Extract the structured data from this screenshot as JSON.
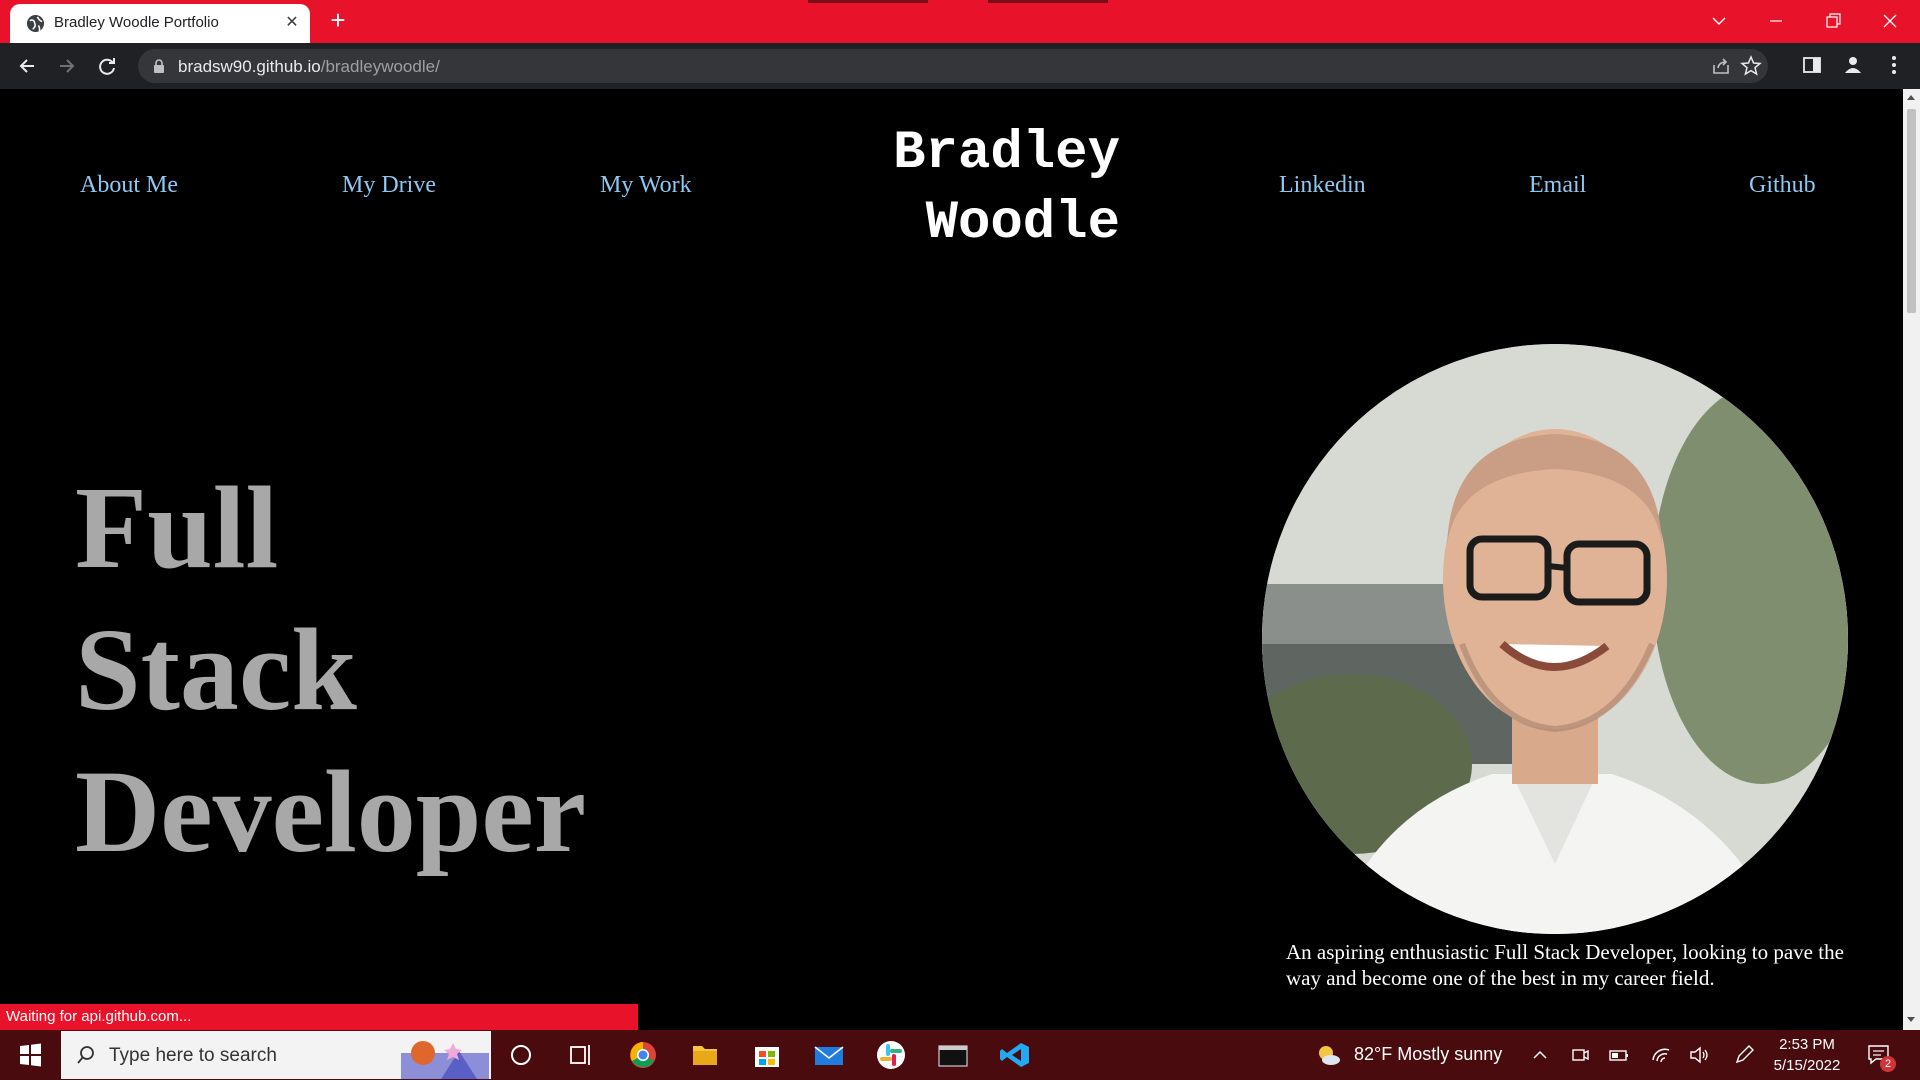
{
  "browser": {
    "tab_title": "Bradley Woodle Portfolio",
    "new_tab_icon": "plus-icon",
    "url_host": "bradsw90.github.io",
    "url_path": "/bradleywoodle/",
    "status_text": "Waiting for api.github.com..."
  },
  "page": {
    "nav_left": [
      "About Me",
      "My Drive",
      "My Work"
    ],
    "site_title_line1": "Bradley",
    "site_title_line2": "Woodle",
    "nav_right": [
      "Linkedin",
      "Email",
      "Github"
    ],
    "hero_line1": "Full",
    "hero_line2": "Stack",
    "hero_line3": "Developer",
    "bio": "An aspiring enthusiastic Full Stack Developer, looking to pave the way and become one of the best in my career field.",
    "colors": {
      "link": "#8fc7f0",
      "hero": "#a8a8a8",
      "background": "#000000",
      "chrome_accent": "#e8132a"
    }
  },
  "taskbar": {
    "search_placeholder": "Type here to search",
    "weather": "82°F  Mostly sunny",
    "time": "2:53 PM",
    "date": "5/15/2022",
    "notification_count": "2"
  }
}
